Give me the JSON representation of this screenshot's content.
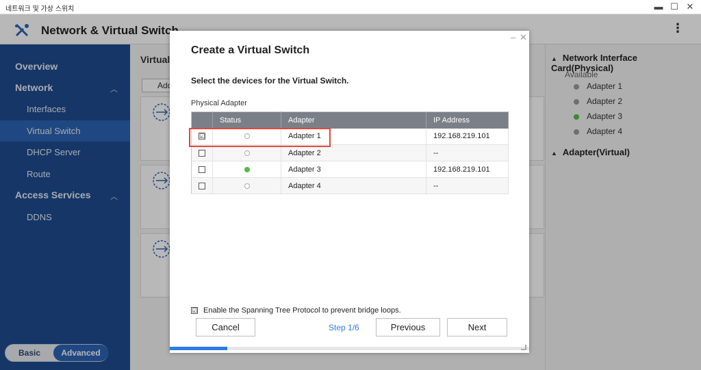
{
  "window": {
    "os_title": "네트워크 및 가상 스위치",
    "minimize": "▬",
    "maximize": "☐",
    "close": "✕"
  },
  "header": {
    "title": "Network & Virtual Switch",
    "more_icon": "⋮"
  },
  "sidebar": {
    "items": [
      {
        "label": "Overview"
      },
      {
        "label": "Network"
      },
      {
        "label": "Interfaces"
      },
      {
        "label": "Virtual Switch"
      },
      {
        "label": "DHCP Server"
      },
      {
        "label": "Route"
      },
      {
        "label": "Access Services"
      },
      {
        "label": "DDNS"
      }
    ],
    "collapse_icon": "︿",
    "mode": {
      "basic": "Basic",
      "advanced": "Advanced"
    }
  },
  "main": {
    "heading": "Virtual",
    "add_label": "Add"
  },
  "right_panel": {
    "section1": "Network Interface Card(Physical)",
    "available": "Available",
    "adapters": [
      "Adapter 1",
      "Adapter 2",
      "Adapter 3",
      "Adapter 4"
    ],
    "adapter_status_colors": [
      "#9a9a9a",
      "#9a9a9a",
      "#4fbf43",
      "#9a9a9a"
    ],
    "section2": "Adapter(Virtual)"
  },
  "dialog": {
    "title": "Create a Virtual Switch",
    "subtitle": "Select the devices for the Virtual Switch.",
    "table_label": "Physical Adapter",
    "columns": [
      "",
      "Status",
      "Adapter",
      "IP Address"
    ],
    "rows": [
      {
        "checked": true,
        "status": "off",
        "adapter": "Adapter 1",
        "ip": "192.168.219.101"
      },
      {
        "checked": false,
        "status": "off",
        "adapter": "Adapter 2",
        "ip": "--"
      },
      {
        "checked": false,
        "status": "green",
        "adapter": "Adapter 3",
        "ip": "192.168.219.101"
      },
      {
        "checked": false,
        "status": "off",
        "adapter": "Adapter 4",
        "ip": "--"
      }
    ],
    "checked_mark": "☑",
    "stp_label": "Enable the Spanning Tree Protocol to prevent bridge loops.",
    "stp_checked": true,
    "cancel": "Cancel",
    "step": "Step 1/6",
    "previous": "Previous",
    "next": "Next",
    "progress": 0.16,
    "minimize": "–",
    "close": "✕"
  },
  "colors": {
    "sidebar_bg": "#1e4c8f",
    "sidebar_active": "#2c63b5",
    "accent": "#2c7be5",
    "status_green": "#4fbf43",
    "highlight": "#e0483a"
  }
}
